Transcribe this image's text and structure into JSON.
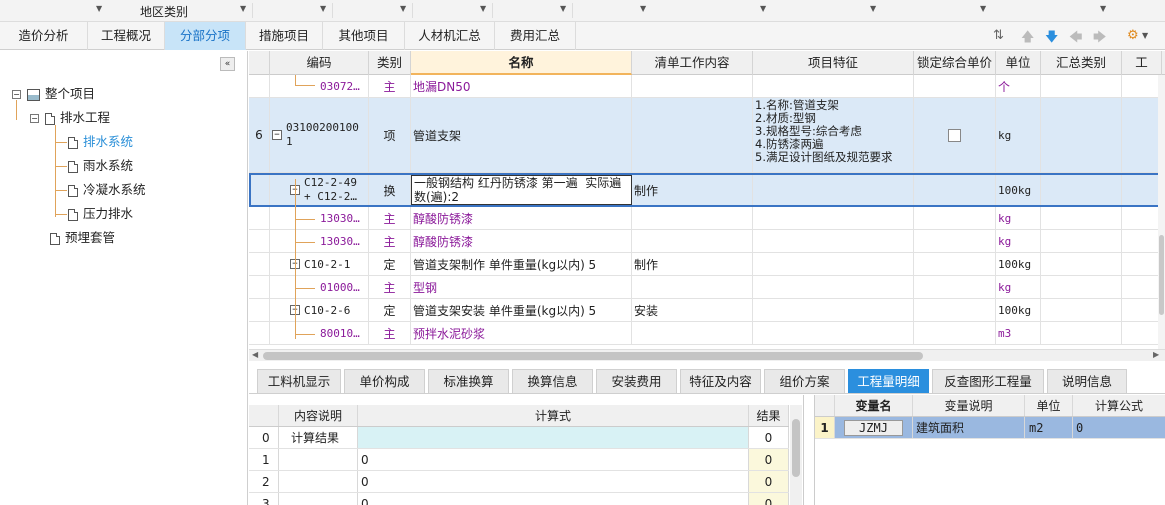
{
  "top_strip": {
    "region_label": "地区类别"
  },
  "tabs": [
    "造价分析",
    "工程概况",
    "分部分项",
    "措施项目",
    "其他项目",
    "人材机汇总",
    "费用汇总"
  ],
  "tree": {
    "root": "整个项目",
    "group": "排水工程",
    "items": [
      "排水系统",
      "雨水系统",
      "冷凝水系统",
      "压力排水"
    ],
    "extra": "预埋套管"
  },
  "grid": {
    "columns": [
      "编码",
      "类别",
      "名称",
      "清单工作内容",
      "项目特征",
      "锁定综合单价",
      "单位",
      "汇总类别",
      "工"
    ],
    "rows": [
      {
        "no": "",
        "code": "03072…",
        "type": "主",
        "name": "地漏DN50",
        "work": "",
        "feature": "",
        "unit": "个"
      },
      {
        "no": "6",
        "code": "03100200100\n1",
        "type": "项",
        "name": "管道支架",
        "work": "",
        "feature": "1.名称:管道支架\n2.材质:型钢\n3.规格型号:综合考虑\n4.防锈漆两遍\n5.满足设计图纸及规范要求",
        "unit": "kg"
      },
      {
        "no": "",
        "code": "C12-2-49\n+ C12-2…",
        "type": "换",
        "name": "一般钢结构 红丹防锈漆 第一遍  实际遍\n数(遍):2",
        "work": "制作",
        "feature": "",
        "unit": "100kg"
      },
      {
        "no": "",
        "code": "13030…",
        "type": "主",
        "name": "醇酸防锈漆",
        "work": "",
        "feature": "",
        "unit": "kg"
      },
      {
        "no": "",
        "code": "13030…",
        "type": "主",
        "name": "醇酸防锈漆",
        "work": "",
        "feature": "",
        "unit": "kg"
      },
      {
        "no": "",
        "code": "C10-2-1",
        "type": "定",
        "name": "管道支架制作 单件重量(kg以内) 5",
        "work": "制作",
        "feature": "",
        "unit": "100kg"
      },
      {
        "no": "",
        "code": "01000…",
        "type": "主",
        "name": "型钢",
        "work": "",
        "feature": "",
        "unit": "kg"
      },
      {
        "no": "",
        "code": "C10-2-6",
        "type": "定",
        "name": "管道支架安装 单件重量(kg以内) 5",
        "work": "安装",
        "feature": "",
        "unit": "100kg"
      },
      {
        "no": "",
        "code": "80010…",
        "type": "主",
        "name": "预拌水泥砂浆",
        "work": "",
        "feature": "",
        "unit": "m3"
      }
    ]
  },
  "bottom_tabs": [
    "工料机显示",
    "单价构成",
    "标准换算",
    "换算信息",
    "安装费用",
    "特征及内容",
    "组价方案",
    "工程量明细",
    "反查图形工程量",
    "说明信息"
  ],
  "calc_table": {
    "columns": [
      "内容说明",
      "计算式",
      "结果"
    ],
    "rows": [
      {
        "idx": "0",
        "desc": "计算结果",
        "formula": "",
        "result": "0"
      },
      {
        "idx": "1",
        "desc": "",
        "formula": "0",
        "result": "0"
      },
      {
        "idx": "2",
        "desc": "",
        "formula": "0",
        "result": "0"
      },
      {
        "idx": "3",
        "desc": "",
        "formula": "0",
        "result": "0"
      }
    ]
  },
  "var_table": {
    "columns": [
      "变量名",
      "变量说明",
      "单位",
      "计算公式"
    ],
    "rows": [
      {
        "idx": "1",
        "name": "JZMJ",
        "desc": "建筑面积",
        "unit": "m2",
        "formula": "0"
      }
    ]
  },
  "colors": {
    "accent": "#2b8fde",
    "purple": "#8b1a9a",
    "tree_line": "#e0a35a"
  }
}
